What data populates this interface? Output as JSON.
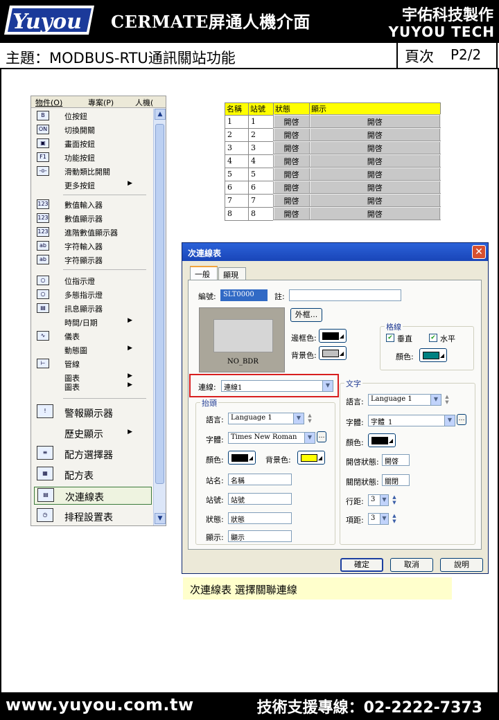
{
  "header": {
    "logo_text": "Yuyou",
    "title": "CERMATE屏通人機介面",
    "company_cn": "宇佑科技製作",
    "company_en": "YUYOU TECH"
  },
  "subject": "主題：MODBUS-RTU通訊關站功能",
  "page": {
    "label": "頁次",
    "number": "P2/2"
  },
  "footer": {
    "url": "www.yuyou.com.tw",
    "hotline": "技術支援專線：02-2222-7373"
  },
  "menu": {
    "menubar": [
      "物件(O)",
      "專案(P)",
      "人機("
    ],
    "items": [
      {
        "icon": "B",
        "label": "位按鈕"
      },
      {
        "icon": "ON",
        "label": "切換開關"
      },
      {
        "icon": "▣",
        "label": "畫面按鈕"
      },
      {
        "icon": "F1",
        "label": "功能按鈕"
      },
      {
        "icon": "-o-",
        "label": "滑動類比開關"
      },
      {
        "icon": "",
        "label": "更多按鈕",
        "submenu": true
      },
      {
        "icon": "123",
        "label": "數值輸入器"
      },
      {
        "icon": "123",
        "label": "數值顯示器"
      },
      {
        "icon": "123",
        "label": "進階數值顯示器"
      },
      {
        "icon": "ab",
        "label": "字符輸入器"
      },
      {
        "icon": "ab",
        "label": "字符顯示器"
      },
      {
        "icon": "○",
        "label": "位指示燈"
      },
      {
        "icon": "○",
        "label": "多態指示燈"
      },
      {
        "icon": "▤",
        "label": "訊息顯示器"
      },
      {
        "icon": "",
        "label": "時間/日期",
        "submenu": true
      },
      {
        "icon": "∿",
        "label": "儀表"
      },
      {
        "icon": "",
        "label": "動態圖",
        "submenu": true
      },
      {
        "icon": "⊢",
        "label": "管線"
      },
      {
        "icon": "",
        "label": "圖表",
        "submenu": true
      },
      {
        "icon": "",
        "label": "圖表",
        "submenu": true
      },
      {
        "icon": "!",
        "label": "警報顯示器"
      },
      {
        "icon": "",
        "label": "歷史顯示",
        "submenu": true
      },
      {
        "icon": "≡",
        "label": "配方選擇器"
      },
      {
        "icon": "▦",
        "label": "配方表"
      },
      {
        "icon": "▤",
        "label": "次連線表"
      },
      {
        "icon": "◷",
        "label": "排程設置表"
      }
    ]
  },
  "preview_table": {
    "headers": [
      "名稱",
      "站號",
      "狀態",
      "顯示"
    ],
    "rows": [
      [
        "1",
        "1",
        "開啓",
        "開啓"
      ],
      [
        "2",
        "2",
        "開啓",
        "開啓"
      ],
      [
        "3",
        "3",
        "開啓",
        "開啓"
      ],
      [
        "4",
        "4",
        "開啓",
        "開啓"
      ],
      [
        "5",
        "5",
        "開啓",
        "開啓"
      ],
      [
        "6",
        "6",
        "開啓",
        "開啓"
      ],
      [
        "7",
        "7",
        "開啓",
        "開啓"
      ],
      [
        "8",
        "8",
        "開啓",
        "開啓"
      ]
    ]
  },
  "dialog": {
    "title": "次連線表",
    "tabs": [
      "一般",
      "顯現"
    ],
    "id_label": "編號:",
    "id_value": "SLT0000",
    "note_label": "註:",
    "note_value": "",
    "frame_button": "外框...",
    "border_color_label": "邊框色:",
    "bg_color_label": "背景色:",
    "preview_label": "NO_BDR",
    "grid_group": "格線",
    "grid_vertical": "垂直",
    "grid_horizontal": "水平",
    "grid_color_label": "顏色:",
    "link_label": "連線:",
    "link_value": "連線1",
    "header_group": "抬頭",
    "text_group": "文字",
    "language_label": "語言:",
    "language_value": "Language 1",
    "font_label": "字體:",
    "header_font_value": "Times New Roman",
    "text_font_value": "字體_1",
    "color_label": "顏色:",
    "header_bg_label": "背景色:",
    "name_label": "站名:",
    "name_value": "名稱",
    "station_label": "站號:",
    "station_value": "站號",
    "state_label": "狀態:",
    "state_value": "狀態",
    "display_label": "顯示:",
    "display_value": "顯示",
    "on_state_label": "開啓狀態:",
    "on_state_value": "開啓",
    "off_state_label": "關閉狀態:",
    "off_state_value": "關閉",
    "row_spacing_label": "行距:",
    "row_spacing_value": "3",
    "col_spacing_label": "項距:",
    "col_spacing_value": "3",
    "ok": "確定",
    "cancel": "取消",
    "help": "說明",
    "colors": {
      "border": "#000000",
      "background": "#c0c0c0",
      "grid": "#008080",
      "header_text": "#000000",
      "header_bg": "#ffff00",
      "text": "#000000"
    }
  },
  "caption": "次連線表 選擇關聯連線"
}
